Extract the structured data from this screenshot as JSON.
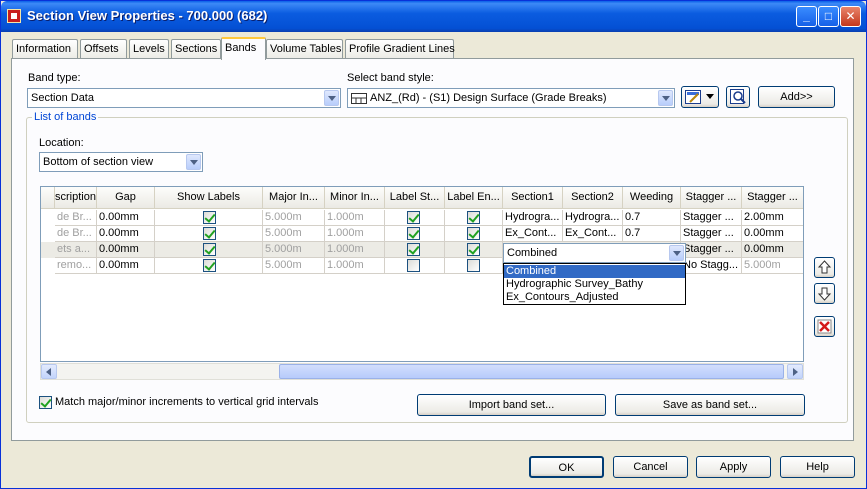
{
  "window": {
    "title": "Section View Properties - 700.000 (682)"
  },
  "tabs": [
    {
      "label": "Information"
    },
    {
      "label": "Offsets"
    },
    {
      "label": "Levels"
    },
    {
      "label": "Sections"
    },
    {
      "label": "Bands",
      "active": true
    },
    {
      "label": "Volume Tables"
    },
    {
      "label": "Profile Gradient Lines"
    }
  ],
  "band_type": {
    "label": "Band type:",
    "value": "Section Data"
  },
  "band_style": {
    "label": "Select band style:",
    "value": "ANZ_(Rd) - (S1) Design Surface (Grade Breaks)"
  },
  "add_button": "Add>>",
  "list_of_bands": {
    "title": "List of bands",
    "location_label": "Location:",
    "location_value": "Bottom of section view",
    "columns": [
      "scription",
      "Gap",
      "Show Labels",
      "Major In...",
      "Minor In...",
      "Label St...",
      "Label En...",
      "Section1",
      "Section2",
      "Weeding",
      "Stagger ...",
      "Stagger ..."
    ],
    "rows": [
      {
        "desc": "de Br...",
        "gap": "0.00mm",
        "show": true,
        "major": "5.000m",
        "minor": "1.000m",
        "lstart": true,
        "lend": true,
        "s1": "Hydrogra...",
        "s2": "Hydrogra...",
        "weed": "0.7",
        "stag1": "Stagger ...",
        "stag2": "2.00mm"
      },
      {
        "desc": "de Br...",
        "gap": "0.00mm",
        "show": true,
        "major": "5.000m",
        "minor": "1.000m",
        "lstart": true,
        "lend": true,
        "s1": "Ex_Cont...",
        "s2": "Ex_Cont...",
        "weed": "0.7",
        "stag1": "Stagger ...",
        "stag2": "0.00mm"
      },
      {
        "desc": "ets a...",
        "gap": "0.00mm",
        "show": true,
        "major": "5.000m",
        "minor": "1.000m",
        "lstart": true,
        "lend": true,
        "s1": "Combined",
        "s2": "",
        "weed": "",
        "stag1": "Stagger ...",
        "stag2": "0.00mm"
      },
      {
        "desc": "remo...",
        "gap": "0.00mm",
        "show": true,
        "major": "5.000m",
        "minor": "1.000m",
        "lstart": false,
        "lend": false,
        "s1": "",
        "s2": "",
        "weed": "",
        "stag1": "No Stagg...",
        "stag2": "5.000m"
      }
    ],
    "dropdown_options": [
      "Combined",
      "Hydrographic Survey_Bathy",
      "Ex_Contours_Adjusted"
    ],
    "dropdown_selected": "Combined"
  },
  "match_checkbox": {
    "label": "Match major/minor increments to vertical grid intervals",
    "checked": true
  },
  "import_button": "Import band set...",
  "save_button": "Save as band set...",
  "footer": {
    "ok": "OK",
    "cancel": "Cancel",
    "apply": "Apply",
    "help": "Help"
  },
  "colors": {
    "title_bar": "#0a5fe8",
    "selection": "#316ac5",
    "group_title": "#0046d5"
  },
  "icons": [
    "app-icon",
    "minimize-icon",
    "maximize-icon",
    "close-icon",
    "edit-style-icon",
    "preview-icon",
    "move-up-icon",
    "move-down-icon",
    "delete-icon",
    "band-style-icon"
  ]
}
